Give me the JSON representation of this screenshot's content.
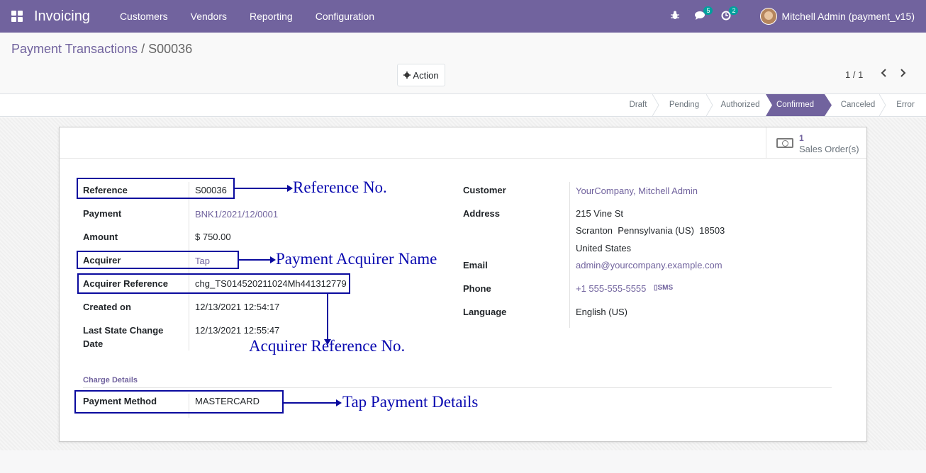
{
  "nav": {
    "app_name": "Invoicing",
    "menu": [
      "Customers",
      "Vendors",
      "Reporting",
      "Configuration"
    ],
    "chat_count": "5",
    "activity_count": "2",
    "user": "Mitchell Admin (payment_v15)"
  },
  "breadcrumb": {
    "parent": "Payment Transactions",
    "separator": "/",
    "current": "S00036"
  },
  "toolbar": {
    "action_label": "Action",
    "pager": "1 / 1"
  },
  "statusbar": {
    "stages": [
      "Draft",
      "Pending",
      "Authorized",
      "Confirmed",
      "Canceled",
      "Error"
    ],
    "active": "Confirmed"
  },
  "smart_button": {
    "value": "1",
    "label": "Sales Order(s)"
  },
  "left_fields": {
    "reference": {
      "label": "Reference",
      "value": "S00036"
    },
    "payment": {
      "label": "Payment",
      "value": "BNK1/2021/12/0001"
    },
    "amount": {
      "label": "Amount",
      "value": "$ 750.00"
    },
    "acquirer": {
      "label": "Acquirer",
      "value": "Tap"
    },
    "acquirer_reference": {
      "label": "Acquirer Reference",
      "value": "chg_TS014520211024Mh441312779"
    },
    "created_on": {
      "label": "Created on",
      "value": "12/13/2021 12:54:17"
    },
    "last_state_change_1": "Last State Change",
    "last_state_change_2": "Date",
    "last_state_change_value": "12/13/2021 12:55:47"
  },
  "right_fields": {
    "customer": {
      "label": "Customer",
      "value": "YourCompany, Mitchell Admin"
    },
    "address": {
      "label": "Address",
      "line1": "215 Vine St",
      "line2": "Scranton  Pennsylvania (US)  18503",
      "line3": "United States"
    },
    "email": {
      "label": "Email",
      "value": "admin@yourcompany.example.com"
    },
    "phone": {
      "label": "Phone",
      "value": "+1 555-555-5555",
      "sms": "SMS"
    },
    "language": {
      "label": "Language",
      "value": "English (US)"
    }
  },
  "charge_details": {
    "title": "Charge Details",
    "payment_method": {
      "label": "Payment Method",
      "value": "MASTERCARD"
    }
  },
  "annotations": {
    "reference_no": "Reference No.",
    "acquirer_name": "Payment Acquirer Name",
    "acquirer_reference_no": "Acquirer Reference No.",
    "tap_details": "Tap Payment Details"
  }
}
